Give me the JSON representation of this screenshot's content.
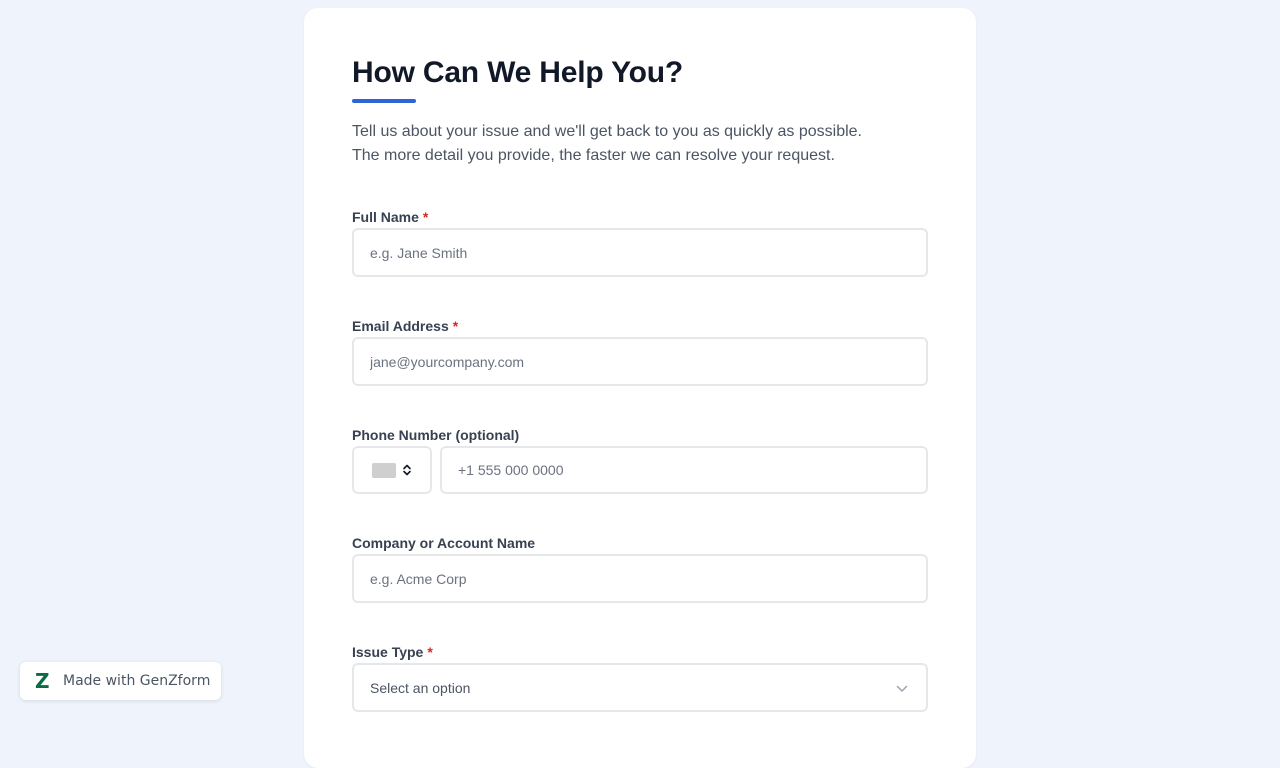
{
  "form": {
    "title": "How Can We Help You?",
    "intro_line1": "Tell us about your issue and we'll get back to you as quickly as possible.",
    "intro_line2": "The more detail you provide, the faster we can resolve your request.",
    "required_marker": "*",
    "accent_color": "#2f64d6",
    "fields": {
      "full_name": {
        "label": "Full Name",
        "required": true,
        "placeholder": "e.g. Jane Smith"
      },
      "email": {
        "label": "Email Address",
        "required": true,
        "placeholder": "jane@yourcompany.com"
      },
      "phone": {
        "label": "Phone Number (optional)",
        "required": false,
        "placeholder": "+1 555 000 0000",
        "country_icon": "flag-placeholder-icon"
      },
      "company": {
        "label": "Company or Account Name",
        "required": false,
        "placeholder": "e.g. Acme Corp"
      },
      "issue_type": {
        "label": "Issue Type",
        "required": true,
        "selected": "Select an option"
      }
    }
  },
  "badge": {
    "logo": "Z",
    "text": "Made with GenZform",
    "logo_color": "#0b6b47"
  }
}
